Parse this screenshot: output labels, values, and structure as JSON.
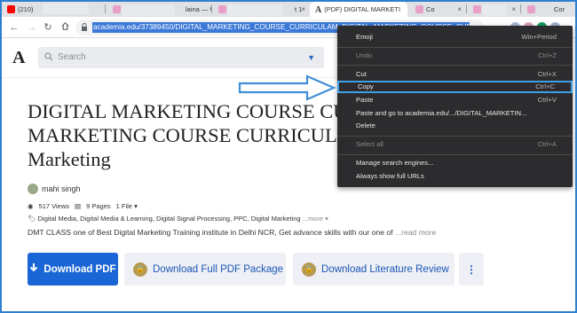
{
  "browser": {
    "tabs": [
      {
        "label": "(210)",
        "favicon_color": "#ff0000",
        "close": "×"
      },
      {
        "label": "laina — W",
        "favicon_color": "#e8a0c8",
        "close": "×"
      },
      {
        "label": "t 1",
        "favicon_color": "#e8a0c8",
        "close": "×"
      },
      {
        "label": "(PDF) DIGITAL MARKETI",
        "favicon_glyph": "A",
        "close": "×"
      },
      {
        "label": "Co",
        "favicon_color": "#e8a0c8",
        "close": "×"
      },
      {
        "label": "",
        "favicon_color": "#e8a0c8",
        "close": "×"
      },
      {
        "label": "Cor",
        "favicon_color": "#e8a0c8",
        "close": ""
      }
    ],
    "url": "academia.edu/37389450/DIGITAL_MARKETING_COURSE_CURRICULAM_DIGITAL_MARKETING_COURSE_CURRIC"
  },
  "site": {
    "logo": "A",
    "search_placeholder": "Search"
  },
  "paper": {
    "title_line1": "DIGITAL MARKETING COURSE CUR",
    "title_line2": "MARKETING COURSE CURRICULAM",
    "title_line3": "Marketing",
    "author": "mahi singh",
    "views": "517 Views",
    "pages": "9 Pages",
    "files": "1 File",
    "tags": "Digital Media, Digital Media & Learning, Digital Signal Processing, PPC, Digital Marketing",
    "tags_more": "...more",
    "description": "DMT CLASS one of Best Digital Marketing Training institute in Delhi NCR, Get advance skills with our one of",
    "read_more": "...read more"
  },
  "buttons": {
    "download_pdf": "Download PDF",
    "download_package": "Download Full PDF Package",
    "download_review": "Download Literature Review",
    "more": "⋮"
  },
  "context_menu": [
    {
      "label": "Emoji",
      "shortcut": "Win+Period",
      "disabled": false
    },
    {
      "label": "Undo",
      "shortcut": "Ctrl+Z",
      "disabled": true
    },
    {
      "label": "Cut",
      "shortcut": "Ctrl+X",
      "disabled": false
    },
    {
      "label": "Copy",
      "shortcut": "Ctrl+C",
      "disabled": false,
      "highlighted": true
    },
    {
      "label": "Paste",
      "shortcut": "Ctrl+V",
      "disabled": false
    },
    {
      "label": "Paste and go to academia.edu/.../DIGITAL_MARKETIN...",
      "shortcut": "",
      "disabled": false
    },
    {
      "label": "Delete",
      "shortcut": "",
      "disabled": false
    },
    {
      "label": "Select all",
      "shortcut": "Ctrl+A",
      "disabled": true
    },
    {
      "label": "Manage search engines...",
      "shortcut": "",
      "disabled": false
    },
    {
      "label": "Always show full URLs",
      "shortcut": "",
      "disabled": false
    }
  ],
  "colors": {
    "accent": "#1a66d6",
    "frame": "#2f7fd0",
    "highlight": "#3fa0e6"
  }
}
